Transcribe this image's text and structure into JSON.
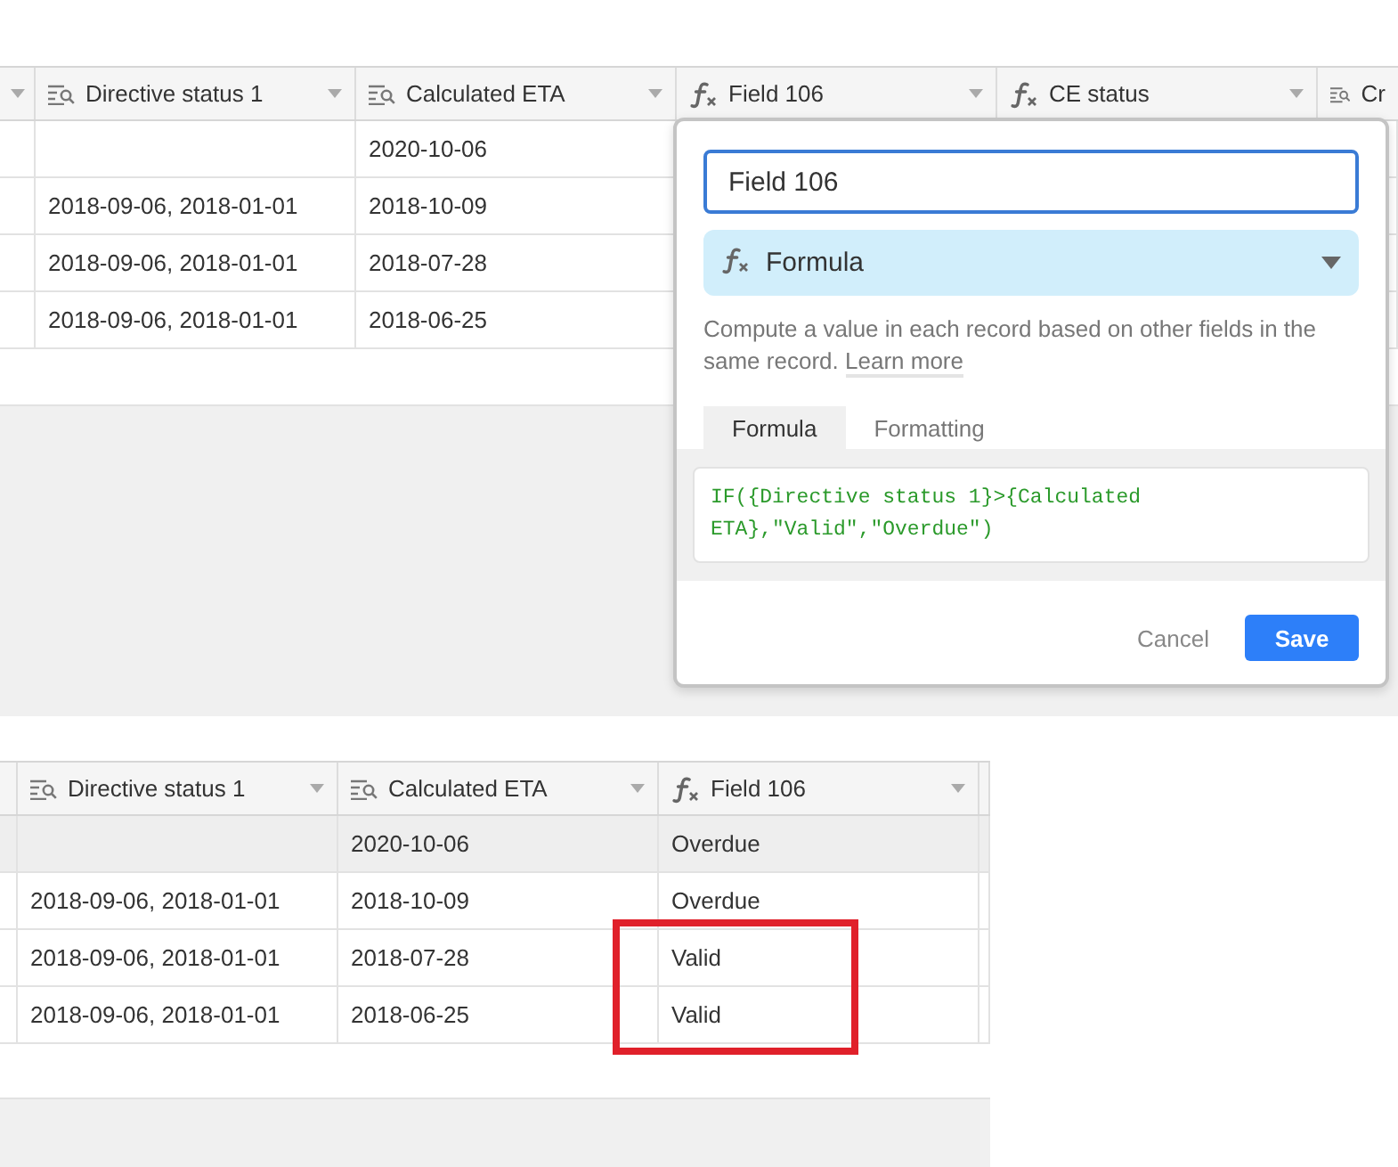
{
  "top_table": {
    "columns": [
      {
        "label": "Directive status 1",
        "kind": "lookup"
      },
      {
        "label": "Calculated ETA",
        "kind": "lookup"
      },
      {
        "label": "Field 106",
        "kind": "formula"
      },
      {
        "label": "CE status",
        "kind": "formula"
      },
      {
        "label": "Cr",
        "kind": "lookup"
      }
    ],
    "rows": [
      {
        "hovered": false,
        "cells": [
          null,
          "2020-10-06"
        ]
      },
      {
        "hovered": false,
        "cells": [
          "2018-09-06, 2018-01-01",
          "2018-10-09"
        ]
      },
      {
        "hovered": false,
        "cells": [
          "2018-09-06, 2018-01-01",
          "2018-07-28"
        ]
      },
      {
        "hovered": false,
        "cells": [
          "2018-09-06, 2018-01-01",
          "2018-06-25"
        ]
      }
    ]
  },
  "field_editor": {
    "name_field": {
      "value": "Field 106"
    },
    "type_select": {
      "kind": "formula",
      "label": "Formula"
    },
    "description": "Compute a value in each record based on other fields in the same record.",
    "link": "Learn more",
    "tabs": [
      {
        "label": "Formula",
        "selected": true
      },
      {
        "label": "Formatting",
        "selected": false
      }
    ],
    "formula": "IF({Directive status 1}>{Calculated ETA},\"Valid\",\"Overdue\")",
    "buttons": {
      "cancel": "Cancel",
      "save": "Save"
    }
  },
  "bottom_table": {
    "columns": [
      {
        "label": "Directive status 1",
        "kind": "lookup"
      },
      {
        "label": "Calculated ETA",
        "kind": "lookup"
      },
      {
        "label": "Field 106",
        "kind": "formula"
      }
    ],
    "rows": [
      {
        "hovered": true,
        "cells": [
          null,
          "2020-10-06",
          "Overdue"
        ]
      },
      {
        "hovered": false,
        "cells": [
          "2018-09-06, 2018-01-01",
          "2018-10-09",
          "Overdue"
        ]
      },
      {
        "hovered": false,
        "cells": [
          "2018-09-06, 2018-01-01",
          "2018-07-28",
          "Valid"
        ]
      },
      {
        "hovered": false,
        "cells": [
          "2018-09-06, 2018-01-01",
          "2018-06-25",
          "Valid"
        ]
      }
    ]
  }
}
